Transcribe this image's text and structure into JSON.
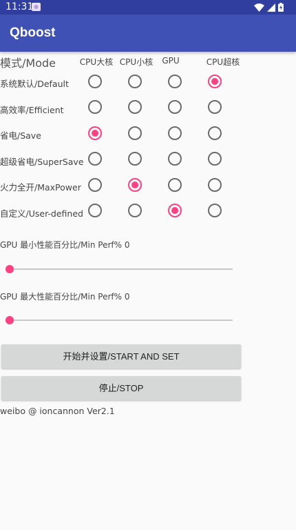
{
  "status_bar": {
    "time": "11:31",
    "icons": [
      "notification-app-icon",
      "wifi-icon",
      "cell-signal-icon",
      "battery-icon"
    ]
  },
  "app_bar": {
    "title": "Qboost"
  },
  "mode_section": {
    "title": "模式/Mode",
    "columns": [
      "CPU大核",
      "CPU小核",
      "GPU",
      "CPU超核"
    ],
    "rows": [
      {
        "label": "系统默认/Default",
        "selected_column": 3
      },
      {
        "label": "高效率/Efficient",
        "selected_column": null
      },
      {
        "label": "省电/Save",
        "selected_column": 0
      },
      {
        "label": "超级省电/SuperSave",
        "selected_column": null
      },
      {
        "label": "火力全开/MaxPower",
        "selected_column": 1
      },
      {
        "label": "自定义/User-defined",
        "selected_column": 2
      }
    ]
  },
  "gpu_min": {
    "label": "GPU 最小性能百分比/Min Perf% 0",
    "value": 0
  },
  "gpu_max": {
    "label": "GPU 最大性能百分比/Min Perf% 0",
    "value": 0
  },
  "buttons": {
    "start": "开始并设置/START AND SET",
    "stop": "停止/STOP"
  },
  "footer": "weibo @ ioncannon Ver2.1",
  "colors": {
    "primary": "#3f51b5",
    "primary_dark": "#303f9f",
    "accent": "#ff4081"
  }
}
